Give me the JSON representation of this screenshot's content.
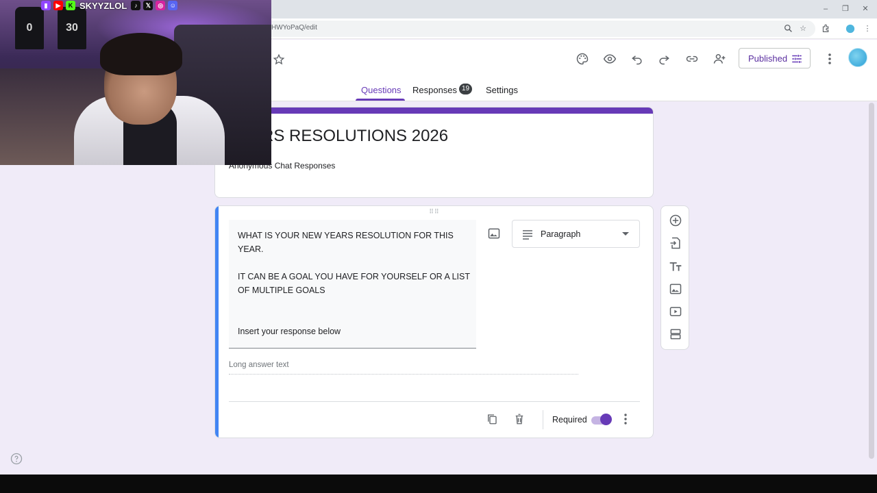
{
  "browser": {
    "url_fragment": "HWYoPaQ/edit"
  },
  "header": {
    "published_label": "Published"
  },
  "tabs": [
    {
      "label": "Questions"
    },
    {
      "label": "Responses",
      "badge": "19"
    },
    {
      "label": "Settings"
    }
  ],
  "form": {
    "title": "YEARS RESOLUTIONS 2026",
    "description": "Anonymous Chat Responses"
  },
  "question": {
    "lines": [
      "WHAT IS YOUR NEW YEARS RESOLUTION FOR THIS",
      "YEAR.",
      "IT CAN BE A GOAL YOU HAVE FOR YOURSELF OR A LIST",
      "OF MULTIPLE GOALS",
      "Insert your response below"
    ],
    "type": "Paragraph",
    "answer_placeholder": "Long answer text",
    "required_label": "Required",
    "required": true
  },
  "overlay": {
    "handle": "SKYYZLOL",
    "jerseys": [
      "0",
      "30"
    ]
  },
  "colors": {
    "accent": "#673ab7",
    "question_bar": "#4285f4",
    "background": "#f0ebf8"
  }
}
